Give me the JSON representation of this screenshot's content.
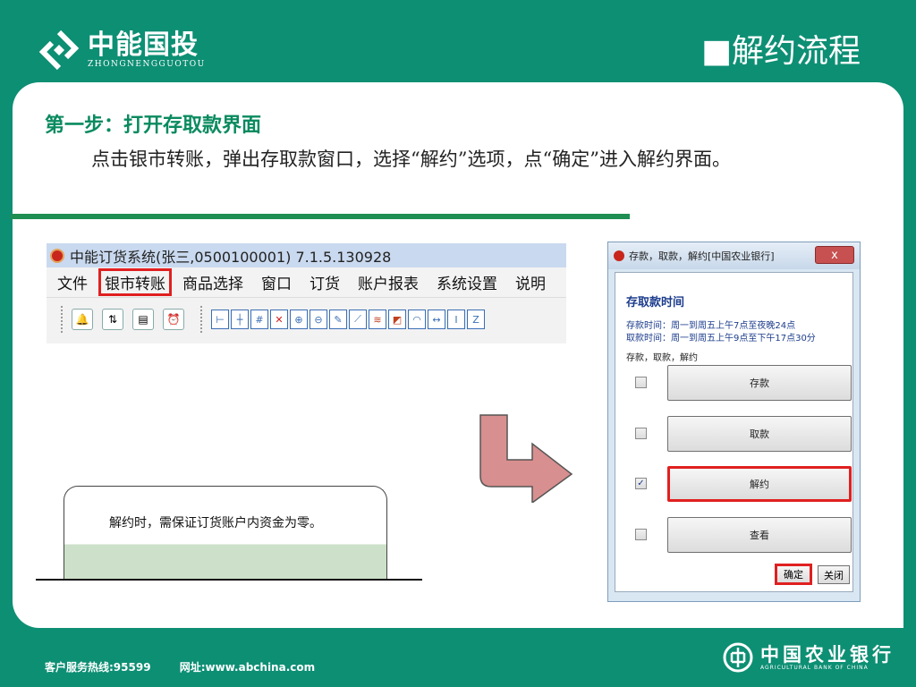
{
  "header": {
    "logo_cn": "中能国投",
    "logo_en": "ZHONGNENGGUOTOU",
    "section_title": "■解约流程"
  },
  "content": {
    "step_title": "第一步：打开存取款界面",
    "step_desc": "点击银市转账，弹出存取款窗口，选择“解约”选项，点“确定”进入解约界面。"
  },
  "app": {
    "title": "中能订货系统(张三,0500100001) 7.1.5.130928",
    "menu": [
      "文件",
      "银市转账",
      "商品选择",
      "窗口",
      "订货",
      "账户报表",
      "系统设置",
      "说明"
    ],
    "highlighted_menu": "银市转账"
  },
  "note": {
    "text": "解约时，需保证订货账户内资金为零。"
  },
  "dialog": {
    "title": "存款，取款，解约[中国农业银行]",
    "close": "x",
    "heading": "存取款时间",
    "deposit_time": "存款时间：周一到周五上午7点至夜晚24点",
    "withdraw_time": "取款时间：周一到周五上午9点至下午17点30分",
    "group_label": "存款，取款，解约",
    "options": [
      {
        "label": "存款",
        "checked": false
      },
      {
        "label": "取款",
        "checked": false
      },
      {
        "label": "解约",
        "checked": true
      },
      {
        "label": "查看",
        "checked": false
      }
    ],
    "ok_label": "确定",
    "close_label": "关闭"
  },
  "footer": {
    "hotline": "客户服务热线:95599",
    "website": "网址:www.abchina.com",
    "bank_cn": "中国农业银行",
    "bank_en": "AGRICULTURAL BANK OF CHINA"
  },
  "colors": {
    "brand_green": "#0d8f74",
    "step_green": "#0a8a5f",
    "highlight_red": "#e02020"
  }
}
